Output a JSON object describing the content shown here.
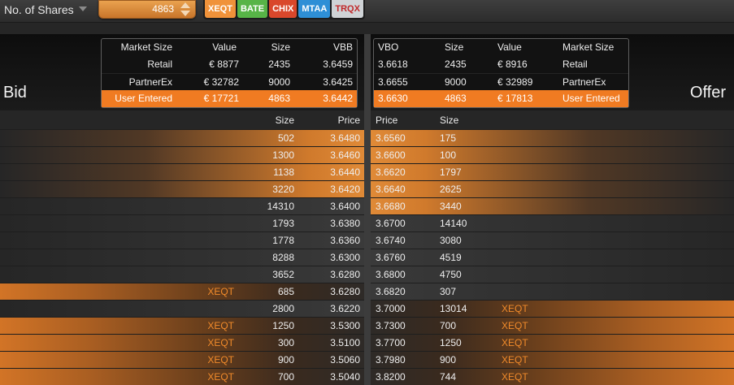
{
  "toolbar": {
    "share_label": "No. of Shares",
    "share_value": "4863",
    "venues": [
      {
        "label": "XEQT",
        "bg": "#f0923a",
        "fg": "#ffffff"
      },
      {
        "label": "BATE",
        "bg": "#57b447",
        "fg": "#ffffff"
      },
      {
        "label": "CHIX",
        "bg": "#d9472b",
        "fg": "#ffffff"
      },
      {
        "label": "MTAA",
        "bg": "#2e8fd6",
        "fg": "#ffffff"
      },
      {
        "label": "TRQX",
        "bg": "#cfd3d6",
        "fg": "#c0282a"
      }
    ]
  },
  "sides": {
    "bid": "Bid",
    "offer": "Offer"
  },
  "bid_market": {
    "headers": [
      "Market Size",
      "Value",
      "Size",
      "VBB"
    ],
    "rows": [
      [
        "Retail",
        "€ 8877",
        "2435",
        "3.6459"
      ],
      [
        "PartnerEx",
        "€ 32782",
        "9000",
        "3.6425"
      ],
      [
        "User Entered",
        "€ 17721",
        "4863",
        "3.6442"
      ]
    ]
  },
  "offer_market": {
    "headers": [
      "VBO",
      "Size",
      "Value",
      "Market Size"
    ],
    "rows": [
      [
        "3.6618",
        "2435",
        "€ 8916",
        "Retail"
      ],
      [
        "3.6655",
        "9000",
        "€ 32989",
        "PartnerEx"
      ],
      [
        "3.6630",
        "4863",
        "€ 17813",
        "User Entered"
      ]
    ]
  },
  "ladder": {
    "headers": {
      "bid_size": "Size",
      "bid_price": "Price",
      "offer_price": "Price",
      "offer_size": "Size"
    },
    "rows": [
      {
        "bid_venue": "",
        "bid_size": "502",
        "bid_price": "3.6480",
        "offer_price": "3.6560",
        "offer_size": "175",
        "offer_venue": "",
        "bid_style": "hl",
        "offer_style": "hl"
      },
      {
        "bid_venue": "",
        "bid_size": "1300",
        "bid_price": "3.6460",
        "offer_price": "3.6600",
        "offer_size": "100",
        "offer_venue": "",
        "bid_style": "hl",
        "offer_style": "hl"
      },
      {
        "bid_venue": "",
        "bid_size": "1138",
        "bid_price": "3.6440",
        "offer_price": "3.6620",
        "offer_size": "1797",
        "offer_venue": "",
        "bid_style": "hl",
        "offer_style": "hl"
      },
      {
        "bid_venue": "",
        "bid_size": "3220",
        "bid_price": "3.6420",
        "offer_price": "3.6640",
        "offer_size": "2625",
        "offer_venue": "",
        "bid_style": "hl",
        "offer_style": "hl"
      },
      {
        "bid_venue": "",
        "bid_size": "14310",
        "bid_price": "3.6400",
        "offer_price": "3.6680",
        "offer_size": "3440",
        "offer_venue": "",
        "bid_style": "dark",
        "offer_style": "hl"
      },
      {
        "bid_venue": "",
        "bid_size": "1793",
        "bid_price": "3.6380",
        "offer_price": "3.6700",
        "offer_size": "14140",
        "offer_venue": "",
        "bid_style": "dark",
        "offer_style": "dark"
      },
      {
        "bid_venue": "",
        "bid_size": "1778",
        "bid_price": "3.6360",
        "offer_price": "3.6740",
        "offer_size": "3080",
        "offer_venue": "",
        "bid_style": "dark",
        "offer_style": "dark"
      },
      {
        "bid_venue": "",
        "bid_size": "8288",
        "bid_price": "3.6300",
        "offer_price": "3.6760",
        "offer_size": "4519",
        "offer_venue": "",
        "bid_style": "dark",
        "offer_style": "dark"
      },
      {
        "bid_venue": "",
        "bid_size": "3652",
        "bid_price": "3.6280",
        "offer_price": "3.6800",
        "offer_size": "4750",
        "offer_venue": "",
        "bid_style": "dark",
        "offer_style": "dark"
      },
      {
        "bid_venue": "XEQT",
        "bid_size": "685",
        "bid_price": "3.6280",
        "offer_price": "3.6820",
        "offer_size": "307",
        "offer_venue": "",
        "bid_style": "full",
        "offer_style": "dark"
      },
      {
        "bid_venue": "",
        "bid_size": "2800",
        "bid_price": "3.6220",
        "offer_price": "3.7000",
        "offer_size": "13014",
        "offer_venue": "XEQT",
        "bid_style": "dark",
        "offer_style": "full"
      },
      {
        "bid_venue": "XEQT",
        "bid_size": "1250",
        "bid_price": "3.5300",
        "offer_price": "3.7300",
        "offer_size": "700",
        "offer_venue": "XEQT",
        "bid_style": "full",
        "offer_style": "full"
      },
      {
        "bid_venue": "XEQT",
        "bid_size": "300",
        "bid_price": "3.5100",
        "offer_price": "3.7700",
        "offer_size": "1250",
        "offer_venue": "XEQT",
        "bid_style": "full",
        "offer_style": "full"
      },
      {
        "bid_venue": "XEQT",
        "bid_size": "900",
        "bid_price": "3.5060",
        "offer_price": "3.7980",
        "offer_size": "900",
        "offer_venue": "XEQT",
        "bid_style": "full",
        "offer_style": "full"
      },
      {
        "bid_venue": "XEQT",
        "bid_size": "700",
        "bid_price": "3.5040",
        "offer_price": "3.8200",
        "offer_size": "744",
        "offer_venue": "XEQT",
        "bid_style": "full",
        "offer_style": "full"
      }
    ]
  }
}
